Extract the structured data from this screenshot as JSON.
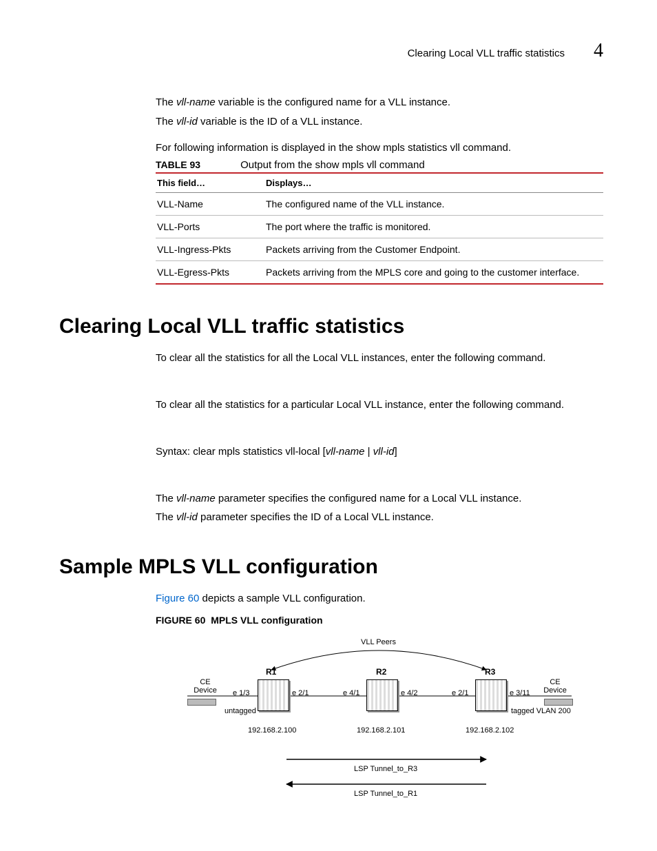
{
  "header": {
    "running_title": "Clearing Local VLL traffic statistics",
    "chapter_number": "4"
  },
  "intro": {
    "line1_pre": "The ",
    "line1_var": "vll-name",
    "line1_post": " variable is the configured name for a VLL instance.",
    "line2_pre": "The ",
    "line2_var": "vll-id",
    "line2_post": " variable is the ID of a VLL instance.",
    "line3": "For following information is displayed in the show mpls statistics vll command."
  },
  "table93": {
    "label": "TABLE 93",
    "caption": "Output from the show mpls vll command",
    "head_field": "This field…",
    "head_disp": "Displays…",
    "rows": [
      {
        "field": "VLL-Name",
        "disp": "The configured name of the VLL instance."
      },
      {
        "field": "VLL-Ports",
        "disp": "The port where the traffic is monitored."
      },
      {
        "field": "VLL-Ingress-Pkts",
        "disp": "Packets arriving from the Customer Endpoint."
      },
      {
        "field": "VLL-Egress-Pkts",
        "disp": "Packets arriving from the MPLS core and going to the customer interface."
      }
    ]
  },
  "section_clear": {
    "title": "Clearing Local VLL traffic statistics",
    "p1": "To clear all the statistics for all the Local VLL instances, enter the following command.",
    "p2": "To clear all the statistics for a particular Local VLL instance, enter the following command.",
    "syntax_pre": "Syntax:  clear mpls statistics vll-local [",
    "syntax_v1": "vll-name",
    "syntax_mid": " | ",
    "syntax_v2": "vll-id",
    "syntax_post": "]",
    "p3_pre": "The ",
    "p3_var": "vll-name",
    "p3_post": " parameter specifies the configured name for a Local VLL instance.",
    "p4_pre": "The ",
    "p4_var": "vll-id",
    "p4_post": " parameter specifies the ID of a Local VLL instance."
  },
  "section_sample": {
    "title": "Sample MPLS VLL configuration",
    "p1_linktext": "Figure 60",
    "p1_post": " depicts a sample VLL configuration.",
    "fig_label": "FIGURE 60",
    "fig_caption": "MPLS VLL configuration"
  },
  "figure60": {
    "top_label": "VLL Peers",
    "r1": "R1",
    "r2": "R2",
    "r3": "R3",
    "ce_left": "CE\nDevice",
    "ce_right": "CE\nDevice",
    "e13": "e 1/3",
    "e21_l": "e 2/1",
    "e41": "e 4/1",
    "e42": "e 4/2",
    "e21_r": "e 2/1",
    "e311": "e 3/11",
    "untagged": "untagged",
    "tagged": "tagged VLAN 200",
    "ip1": "192.168.2.100",
    "ip2": "192.168.2.101",
    "ip3": "192.168.2.102",
    "lsp1": "LSP Tunnel_to_R3",
    "lsp2": "LSP Tunnel_to_R1"
  }
}
